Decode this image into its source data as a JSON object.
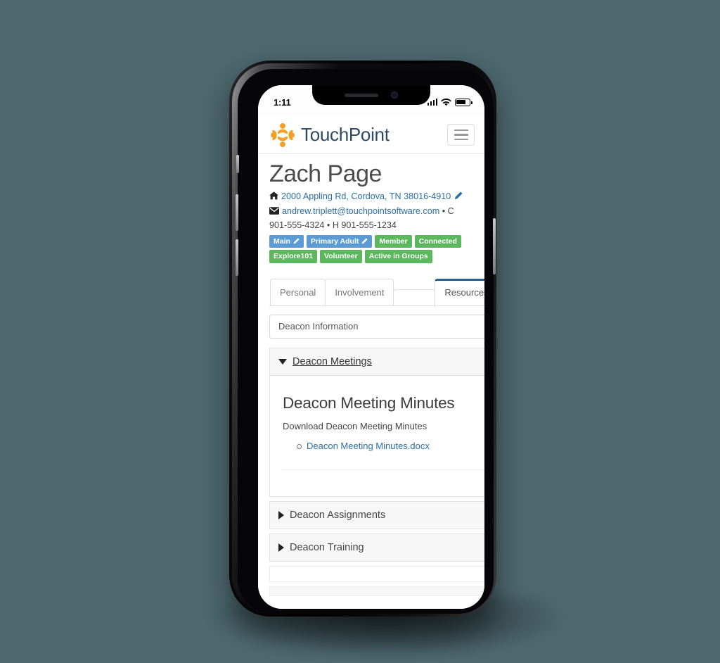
{
  "background_color": "#4d686f",
  "device": {
    "status_bar": {
      "time": "1:11",
      "signal_icon": "cellular-signal-icon",
      "wifi_icon": "wifi-icon",
      "battery_icon": "battery-icon"
    },
    "buttons": {
      "mute": "silent-switch",
      "volume_up": "volume-up-button",
      "volume_down": "volume-down-button",
      "power": "power-button"
    }
  },
  "app": {
    "navbar": {
      "logo_icon": "touchpoint-logo-icon",
      "brand": "TouchPoint",
      "menu_icon": "hamburger-menu-icon"
    },
    "person": {
      "name": "Zach Page",
      "address": {
        "icon": "home-icon",
        "text": "2000 Appling Rd, Cordova, TN 38016-4910",
        "edit_icon": "pencil-icon"
      },
      "email_line": {
        "icon": "envelope-icon",
        "email": "andrew.triplett@touchpointsoftware.com",
        "separator": " • ",
        "phones": "C 901-555-4324 • H 901-555-1234"
      },
      "badges": [
        {
          "label": "Main",
          "color": "#5b9bd5",
          "editable": true
        },
        {
          "label": "Primary Adult",
          "color": "#5b9bd5",
          "editable": true
        },
        {
          "label": "Member",
          "color": "#5cb85c",
          "editable": false
        },
        {
          "label": "Connected",
          "color": "#5cb85c",
          "editable": false
        },
        {
          "label": "Explore101",
          "color": "#5cb85c",
          "editable": false
        },
        {
          "label": "Volunteer",
          "color": "#5cb85c",
          "editable": false
        },
        {
          "label": "Active in Groups",
          "color": "#5cb85c",
          "editable": false
        }
      ]
    },
    "tabs": [
      {
        "label": "Personal",
        "active": false
      },
      {
        "label": "Involvement",
        "active": false
      },
      {
        "label": "",
        "active": false
      },
      {
        "label": "Resources",
        "active": true,
        "has_caret": true
      }
    ],
    "active_tab_accent": "#2c5f8e",
    "resource_select": {
      "value": "Deacon Information",
      "caret_icon": "chevron-down-icon"
    },
    "accordion": [
      {
        "title": "Deacon Meetings",
        "expanded": true,
        "icon": "triangle-down-icon",
        "content": {
          "heading": "Deacon Meeting Minutes",
          "description": "Download Deacon Meeting Minutes",
          "links": [
            "Deacon Meeting Minutes.docx"
          ]
        }
      },
      {
        "title": "Deacon Assignments",
        "expanded": false,
        "icon": "triangle-right-icon"
      },
      {
        "title": "Deacon Training",
        "expanded": false,
        "icon": "triangle-right-icon"
      }
    ]
  }
}
